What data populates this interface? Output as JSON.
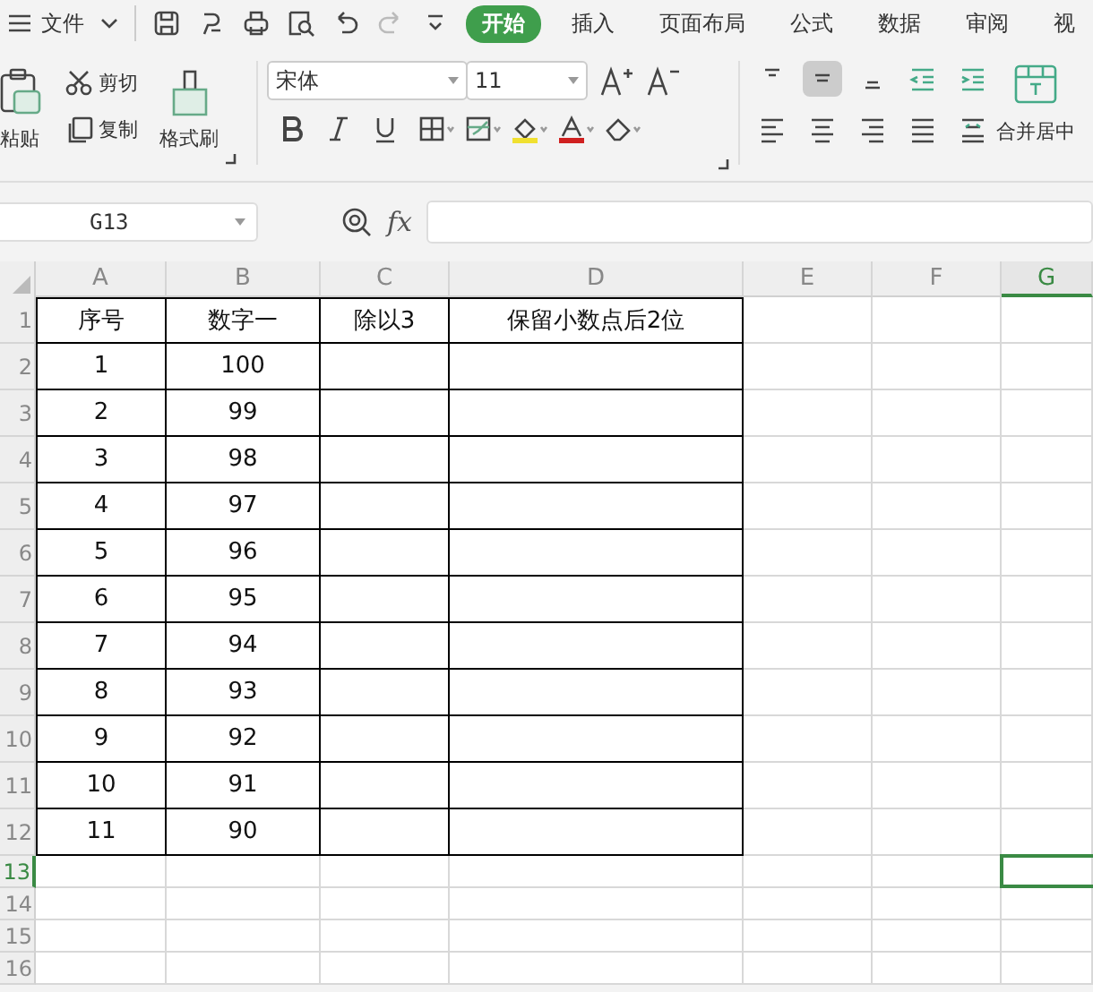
{
  "menu": {
    "file": "文件",
    "tabs": [
      {
        "label": "开始",
        "selected": true
      },
      {
        "label": "插入",
        "selected": false
      },
      {
        "label": "页面布局",
        "selected": false
      },
      {
        "label": "公式",
        "selected": false
      },
      {
        "label": "数据",
        "selected": false
      },
      {
        "label": "审阅",
        "selected": false
      },
      {
        "label": "视",
        "selected": false
      }
    ]
  },
  "ribbon": {
    "paste": "粘贴",
    "cut": "剪切",
    "copy": "复制",
    "format_painter": "格式刷",
    "font_name": "宋体",
    "font_size": "11",
    "merge": "合并居中"
  },
  "formula_bar": {
    "cell_ref": "G13",
    "fx": "fx"
  },
  "sheet": {
    "columns": [
      {
        "label": "A",
        "selected": false
      },
      {
        "label": "B",
        "selected": false
      },
      {
        "label": "C",
        "selected": false
      },
      {
        "label": "D",
        "selected": false
      },
      {
        "label": "E",
        "selected": false
      },
      {
        "label": "F",
        "selected": false
      },
      {
        "label": "G",
        "selected": true
      }
    ],
    "rows": [
      {
        "label": "1",
        "selected": false,
        "cells": [
          "序号",
          "数字一",
          "除以3",
          "保留小数点后2位"
        ]
      },
      {
        "label": "2",
        "selected": false,
        "cells": [
          "1",
          "100"
        ]
      },
      {
        "label": "3",
        "selected": false,
        "cells": [
          "2",
          "99"
        ]
      },
      {
        "label": "4",
        "selected": false,
        "cells": [
          "3",
          "98"
        ]
      },
      {
        "label": "5",
        "selected": false,
        "cells": [
          "4",
          "97"
        ]
      },
      {
        "label": "6",
        "selected": false,
        "cells": [
          "5",
          "96"
        ]
      },
      {
        "label": "7",
        "selected": false,
        "cells": [
          "6",
          "95"
        ]
      },
      {
        "label": "8",
        "selected": false,
        "cells": [
          "7",
          "94"
        ]
      },
      {
        "label": "9",
        "selected": false,
        "cells": [
          "8",
          "93"
        ]
      },
      {
        "label": "10",
        "selected": false,
        "cells": [
          "9",
          "92"
        ]
      },
      {
        "label": "11",
        "selected": false,
        "cells": [
          "10",
          "91"
        ]
      },
      {
        "label": "12",
        "selected": false,
        "cells": [
          "11",
          "90"
        ]
      },
      {
        "label": "13",
        "selected": true
      },
      {
        "label": "14",
        "selected": false
      },
      {
        "label": "15",
        "selected": false
      },
      {
        "label": "16",
        "selected": false
      }
    ]
  }
}
